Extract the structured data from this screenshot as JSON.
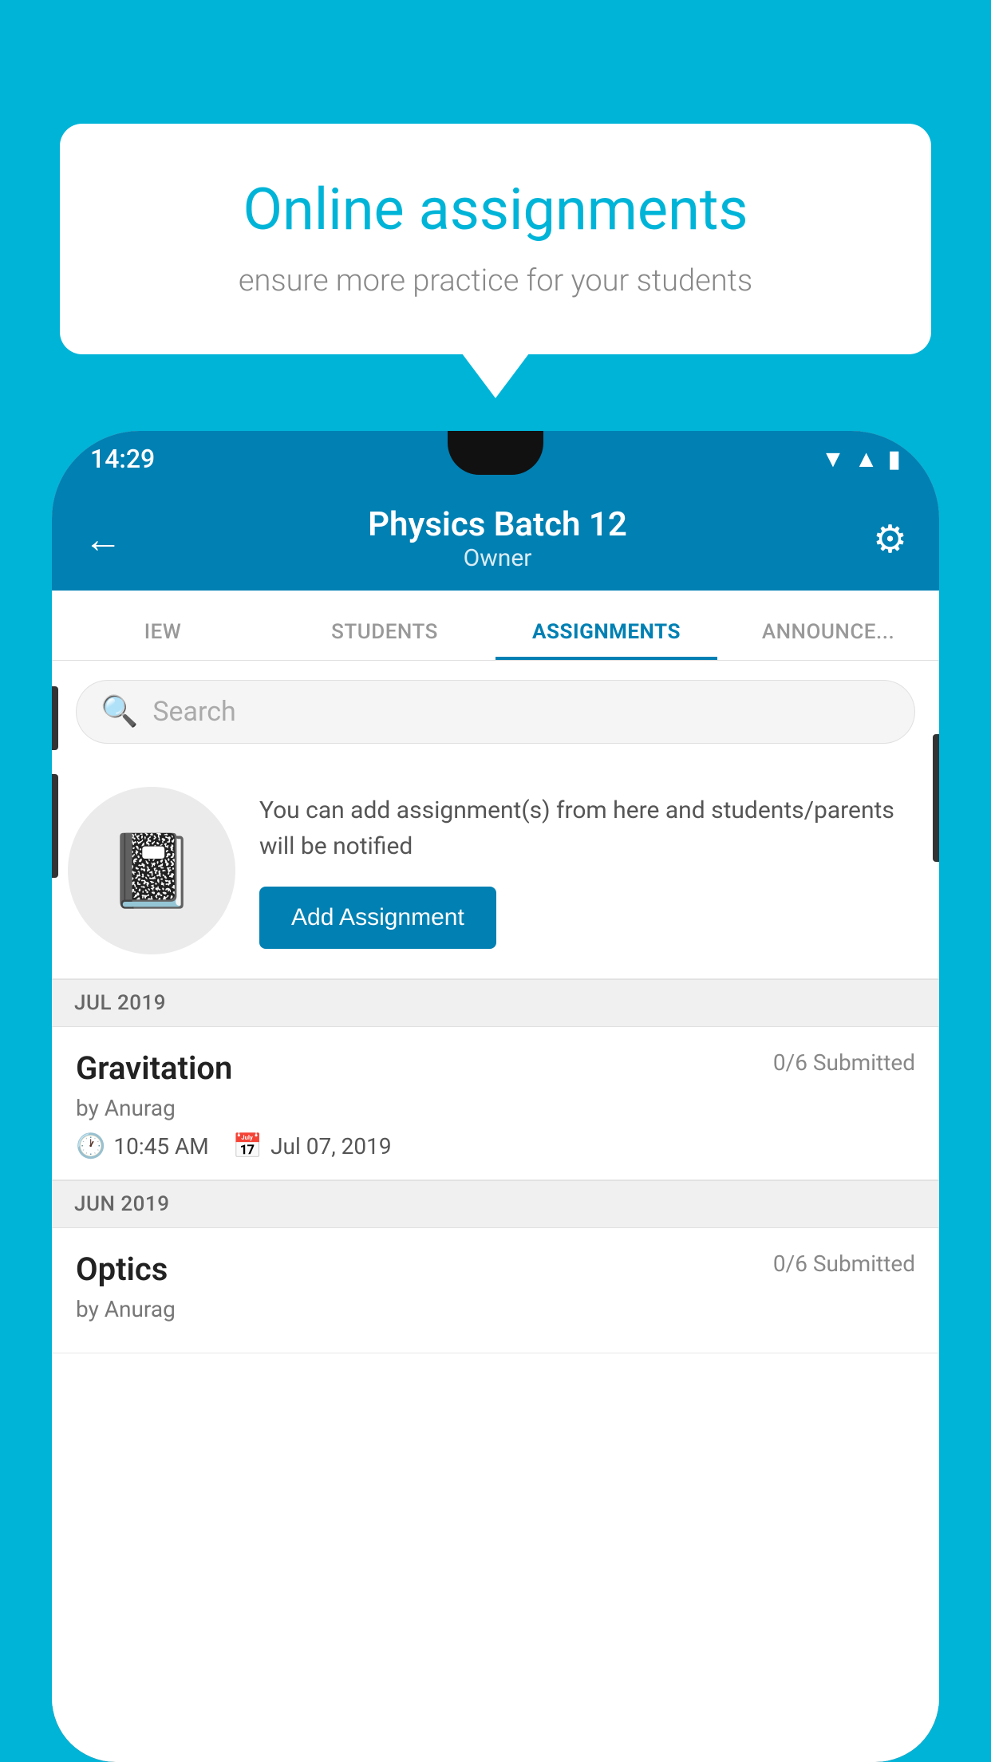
{
  "background_color": "#00b4d8",
  "speech_bubble": {
    "title": "Online assignments",
    "subtitle": "ensure more practice for your students"
  },
  "status_bar": {
    "time": "14:29"
  },
  "header": {
    "title": "Physics Batch 12",
    "subtitle": "Owner",
    "back_label": "←",
    "settings_label": "⚙"
  },
  "tabs": [
    {
      "label": "IEW",
      "active": false
    },
    {
      "label": "STUDENTS",
      "active": false
    },
    {
      "label": "ASSIGNMENTS",
      "active": true
    },
    {
      "label": "ANNOUNCE...",
      "active": false
    }
  ],
  "search": {
    "placeholder": "Search"
  },
  "add_section": {
    "description": "You can add assignment(s) from here and students/parents will be notified",
    "button_label": "Add Assignment"
  },
  "sections": [
    {
      "month": "JUL 2019",
      "assignments": [
        {
          "name": "Gravitation",
          "submitted": "0/6 Submitted",
          "author": "by Anurag",
          "time": "10:45 AM",
          "date": "Jul 07, 2019"
        }
      ]
    },
    {
      "month": "JUN 2019",
      "assignments": [
        {
          "name": "Optics",
          "submitted": "0/6 Submitted",
          "author": "by Anurag",
          "time": "",
          "date": ""
        }
      ]
    }
  ]
}
